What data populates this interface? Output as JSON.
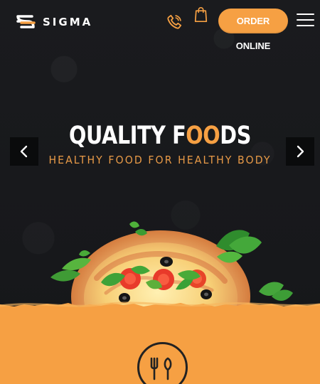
{
  "header": {
    "brand_name": "SIGMA",
    "order_button_label": "ORDER ONLINE"
  },
  "hero": {
    "title_part_1": "QUALITY F",
    "title_accent": "OO",
    "title_part_2": "DS",
    "subtitle": "HEALTHY FOOD FOR HEALTHY BODY"
  },
  "icons": {
    "logo": "sigma-logo",
    "phone": "phone-icon",
    "bag": "shopping-bag-icon",
    "menu": "menu-icon",
    "previous": "chevron-left-icon",
    "next": "chevron-right-icon",
    "service": "cutlery-icon"
  },
  "colors": {
    "background": "#1b1c1f",
    "accent": "#f6a043",
    "text": "#ffffff"
  }
}
